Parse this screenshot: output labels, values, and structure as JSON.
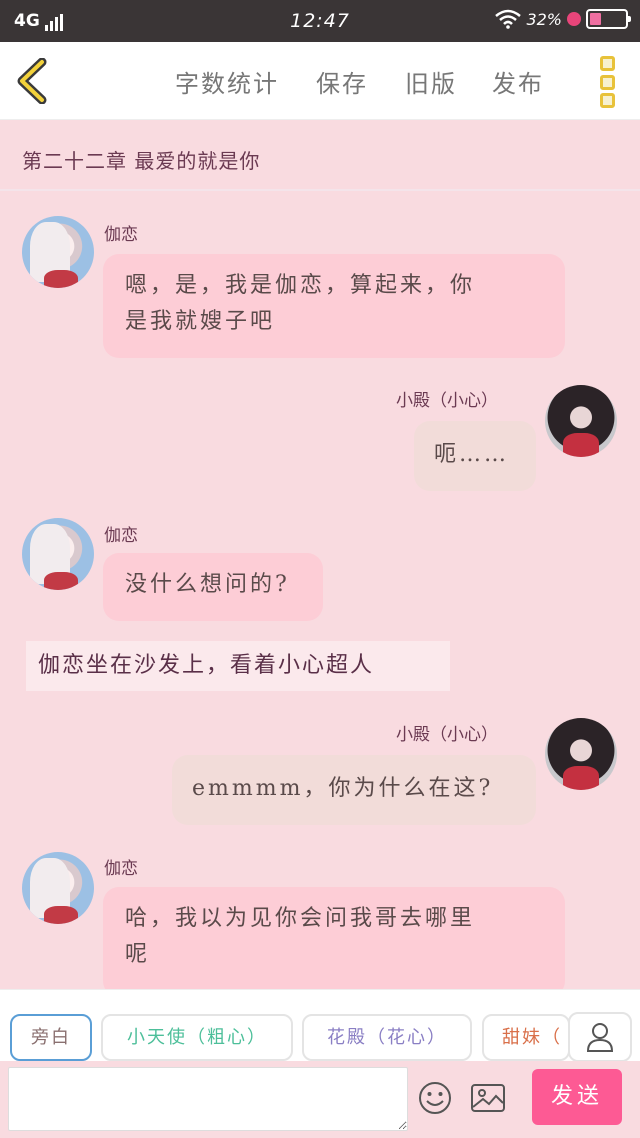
{
  "status_bar": {
    "network": "4G",
    "time": "12:47",
    "battery_text": "32%",
    "battery_level": 0.32
  },
  "toolbar": {
    "back_icon": "chevron-left-icon",
    "menu": [
      "字数统计",
      "保存",
      "旧版",
      "发布"
    ],
    "more_icon": "more-vertical-icon"
  },
  "chapter": {
    "title": "第二十二章 最爱的就是你"
  },
  "messages": [
    {
      "speaker": "伽恋",
      "text_lines": [
        "嗯，是，我是伽恋，算起来，你",
        "是我就嫂子吧"
      ]
    },
    {
      "speaker": "小殿（小心）",
      "text_lines": [
        "呃……"
      ]
    },
    {
      "speaker": "伽恋",
      "text_lines": [
        "没什么想问的?"
      ]
    },
    {
      "narration": "伽恋坐在沙发上，看着小心超人"
    },
    {
      "speaker": "小殿（小心）",
      "text_lines": [
        "emmmm，你为什么在这?"
      ]
    },
    {
      "speaker": "伽恋",
      "text_lines": [
        "哈，我以为见你会问我哥去哪里",
        "呢"
      ]
    }
  ],
  "roles": [
    {
      "label": "旁白",
      "color": "#8a7070"
    },
    {
      "label": "小天使（粗心）",
      "color": "#4dbf9a"
    },
    {
      "label": "花殿（花心）",
      "color": "#8a7fc4"
    },
    {
      "label": "甜妹（",
      "color": "#d9704a"
    }
  ],
  "input": {
    "value": "",
    "send_label": "发送"
  },
  "colors": {
    "background": "#f9dbe0",
    "left_bubble": "#fdcdd6",
    "right_bubble": "#f2dcd9",
    "send_button": "#fd5a94",
    "active_role_border": "#5a9ed6"
  }
}
